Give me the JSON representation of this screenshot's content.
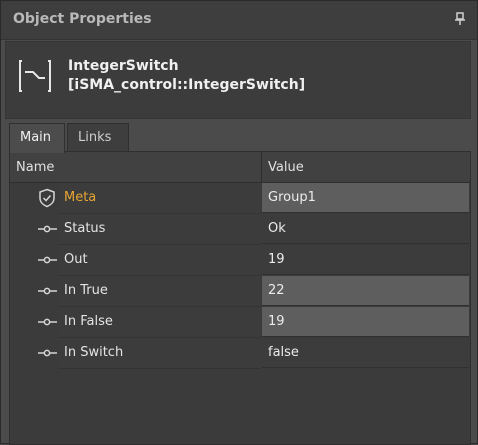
{
  "panel": {
    "title": "Object Properties"
  },
  "object": {
    "name": "IntegerSwitch",
    "type": "[iSMA_control::IntegerSwitch]",
    "icon": "integer-switch-icon"
  },
  "tabs": [
    {
      "label": "Main",
      "active": true
    },
    {
      "label": "Links",
      "active": false
    }
  ],
  "columns": {
    "name": "Name",
    "value": "Value"
  },
  "rows": [
    {
      "label": "Meta",
      "value": "Group1",
      "icon": "shield-icon"
    },
    {
      "label": "Status",
      "value": "Ok",
      "icon": "slot-icon"
    },
    {
      "label": "Out",
      "value": "19",
      "icon": "slot-icon"
    },
    {
      "label": "In True",
      "value": "22",
      "icon": "slot-icon"
    },
    {
      "label": "In False",
      "value": "19",
      "icon": "slot-icon"
    },
    {
      "label": "In Switch",
      "value": "false",
      "icon": "slot-icon"
    }
  ],
  "colors": {
    "meta_label": "#e8a531",
    "editable_cell": "#5e5e5e"
  }
}
